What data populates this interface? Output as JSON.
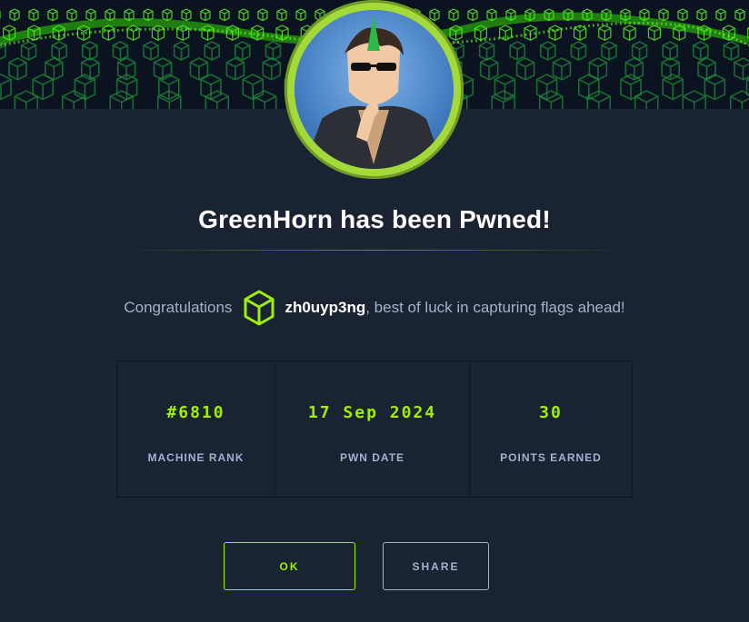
{
  "dialog": {
    "title": "GreenHorn has been Pwned!",
    "congrats_prefix": "Congratulations",
    "username": "zh0uyp3ng",
    "congrats_suffix": ", best of luck in capturing flags ahead!"
  },
  "stats": [
    {
      "value": "#6810",
      "label": "MACHINE RANK"
    },
    {
      "value": "17 Sep 2024",
      "label": "PWN DATE"
    },
    {
      "value": "30",
      "label": "POINTS EARNED"
    }
  ],
  "buttons": {
    "ok": "OK",
    "share": "SHARE"
  },
  "colors": {
    "accent": "#9fef00",
    "background": "#1a2332",
    "muted_text": "#a4b1cd"
  }
}
